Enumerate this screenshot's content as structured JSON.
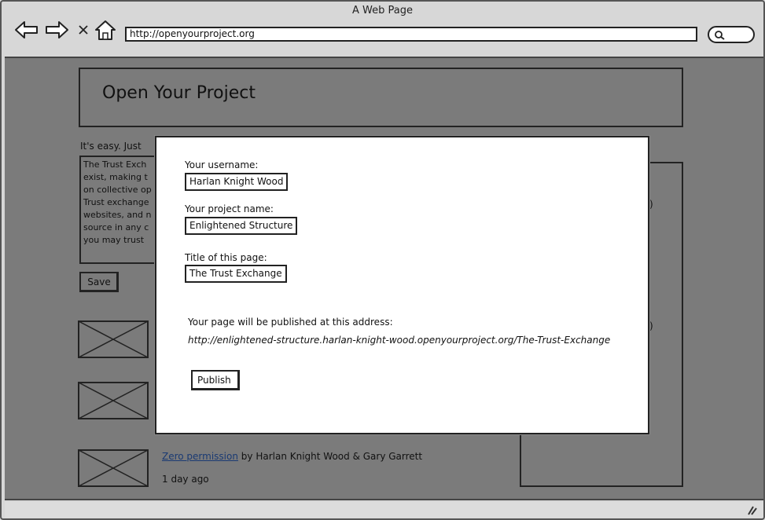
{
  "window": {
    "title": "A Web Page",
    "url": "http://openyourproject.org"
  },
  "page": {
    "header_title": "Open Your Project",
    "intro_text": "It's easy.  Just",
    "description_lines": [
      "The Trust Exch",
      "exist, making t",
      "on collective op",
      "Trust exchange",
      "websites, and n",
      "source in any c",
      "you may trust"
    ],
    "save_label": "Save",
    "right_panel_marks": [
      ")",
      ")"
    ],
    "list_item": {
      "link_text": "Zero permission",
      "by_text": " by Harlan Knight Wood & Gary Garrett",
      "date": "1 day ago"
    }
  },
  "modal": {
    "username_label": "Your username:",
    "username_value": "Harlan Knight Wood",
    "project_label": "Your project name:",
    "project_value": "Enlightened Structure",
    "title_label": "Title of this page:",
    "title_value": "The Trust Exchange",
    "address_label": "Your page will be published at this address:",
    "address_url": "http://enlightened-structure.harlan-knight-wood.openyourproject.org/The-Trust-Exchange",
    "publish_label": "Publish"
  }
}
